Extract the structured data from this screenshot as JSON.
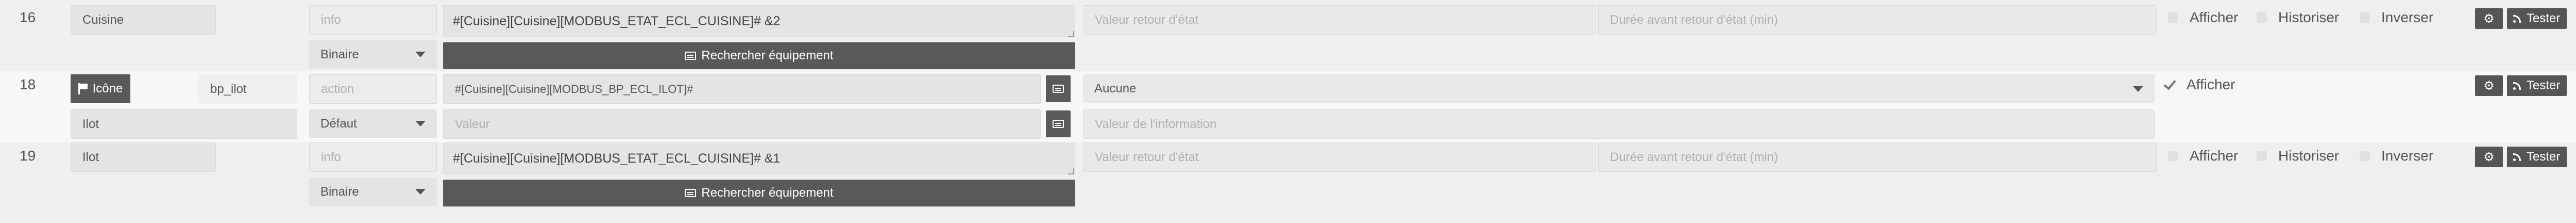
{
  "rows": [
    {
      "number": "16",
      "name": "Cuisine",
      "type_placeholder": "info",
      "subtype": "Binaire",
      "request": "#[Cuisine][Cuisine][MODBUS_ETAT_ECL_CUISINE]# &2",
      "search_label": "Rechercher équipement",
      "return_state_placeholder": "Valeur retour d'état",
      "return_delay_placeholder": "Durée avant retour d'état (min)",
      "afficher": "Afficher",
      "historiser": "Historiser",
      "inverser": "Inverser",
      "tester": "Tester"
    },
    {
      "number": "18",
      "icone_label": "Icône",
      "name": "bp_ilot",
      "type_placeholder": "action",
      "request": "#[Cuisine][Cuisine][MODBUS_BP_ECL_ILOT]#",
      "linked_info": "Aucune",
      "afficher": "Afficher",
      "tester": "Tester",
      "info_name": "Ilot",
      "subtype": "Défaut",
      "value_placeholder": "Valeur",
      "info_value_placeholder": "Valeur de l'information"
    },
    {
      "number": "19",
      "name": "Ilot",
      "type_placeholder": "info",
      "subtype": "Binaire",
      "request": "#[Cuisine][Cuisine][MODBUS_ETAT_ECL_CUISINE]# &1",
      "search_label": "Rechercher équipement",
      "return_state_placeholder": "Valeur retour d'état",
      "return_delay_placeholder": "Durée avant retour d'état (min)",
      "afficher": "Afficher",
      "historiser": "Historiser",
      "inverser": "Inverser",
      "tester": "Tester"
    }
  ]
}
